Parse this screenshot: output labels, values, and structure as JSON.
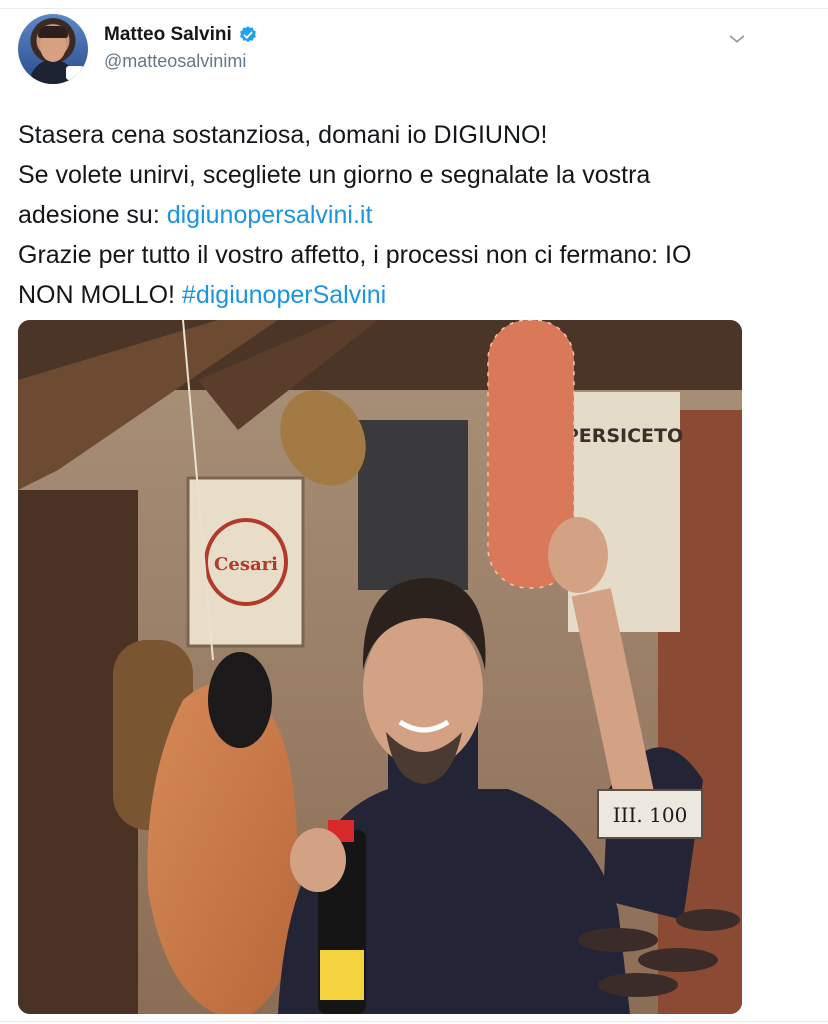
{
  "tweet": {
    "author": {
      "display_name": "Matteo Salvini",
      "handle": "@matteosalvinimi",
      "verified": true,
      "avatar_icon": "profile-photo"
    },
    "menu_icon": "chevron-down-icon",
    "text_lines": [
      [
        {
          "t": "Stasera cena sostanziosa, domani io DIGIUNO!",
          "link": false
        }
      ],
      [
        {
          "t": "Se volete unirvi, scegliete un giorno e segnalate la vostra",
          "link": false
        }
      ],
      [
        {
          "t": "adesione su: ",
          "link": false
        },
        {
          "t": "digiunopersalvini.it",
          "link": true
        }
      ],
      [
        {
          "t": "Grazie per tutto il vostro affetto, i processi non ci fermano: IO",
          "link": false
        }
      ],
      [
        {
          "t": "NON MOLLO! ",
          "link": false
        },
        {
          "t": "#digiunoperSalvini",
          "link": true
        }
      ]
    ],
    "photo": {
      "signs": {
        "persiceto": "PERSICETO",
        "cesari": "Cesari",
        "number_plate": "III. 100"
      }
    }
  },
  "colors": {
    "link": "#1b95e0",
    "verified": "#1da1f2",
    "secondary_text": "#657786"
  }
}
